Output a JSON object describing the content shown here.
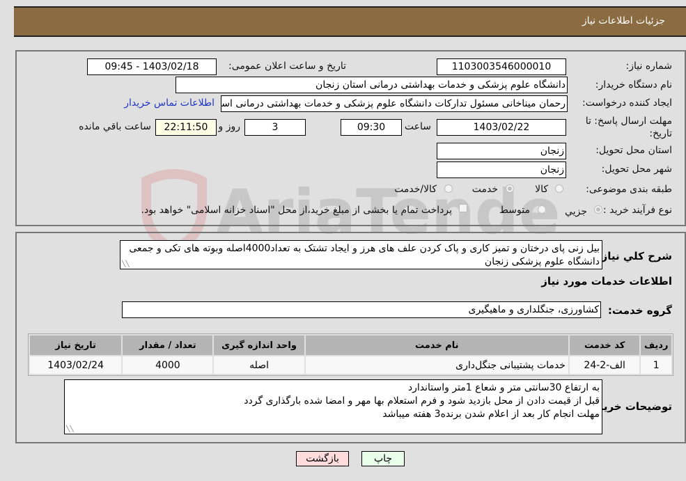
{
  "header": {
    "title": "جزئیات اطلاعات نیاز"
  },
  "fields": {
    "need_number_label": "شماره نیاز:",
    "need_number": "1103003546000010",
    "announce_label": "تاریخ و ساعت اعلان عمومی:",
    "announce_value": "1403/02/18 - 09:45",
    "buyer_org_label": "نام دستگاه خریدار:",
    "buyer_org": "دانشگاه علوم پزشکی و خدمات بهداشتی  درمانی استان زنجان",
    "creator_label": "ایجاد کننده درخواست:",
    "creator": "رحمان میناخانی مسئول تدارکات دانشگاه علوم پزشکی و خدمات بهداشتی  درمانی استان زنجان",
    "contact_link": "اطلاعات تماس خریدار",
    "deadline_label": "مهلت ارسال پاسخ: تا تاریخ:",
    "deadline_date": "1403/02/22",
    "time_label": "ساعت",
    "deadline_time": "09:30",
    "days_value": "3",
    "days_label": "روز و",
    "remaining_time": "22:11:50",
    "remaining_label": "ساعت باقي مانده",
    "province_label": "استان محل تحویل:",
    "province": "زنجان",
    "city_label": "شهر محل تحویل:",
    "city": "زنجان",
    "category_label": "طبقه بندی موضوعی:",
    "category_options": [
      "کالا",
      "خدمت",
      "کالا/خدمت"
    ],
    "category_selected": "خدمت",
    "process_label": "نوع فرآیند خرید :",
    "process_options": [
      "جزيي",
      "متوسط"
    ],
    "process_selected": "جزيي",
    "treasury_note": "پرداخت تمام یا بخشی از مبلغ خرید،از محل \"اسناد خزانه اسلامی\" خواهد بود."
  },
  "description": {
    "label": "شرح کلي نیاز:",
    "text": "بیل زنی پای درختان و تمیز کاری و پاک کردن علف های هرز و ایجاد تشتک  به تعداد4000اصله  وبوته های تکی و جمعی دانشگاه علوم پزشکی زنجان"
  },
  "services": {
    "section_title": "اطلاعات خدمات مورد نیاز",
    "group_label": "گروه خدمت:",
    "group_value": "کشاورزی، جنگلداری و ماهیگیری",
    "columns": [
      "ردیف",
      "کد خدمت",
      "نام خدمت",
      "واحد اندازه گیری",
      "تعداد / مقدار",
      "تاریخ نیاز"
    ],
    "rows": [
      {
        "index": "1",
        "code": "الف-2-24",
        "name": "خدمات پشتیبانی جنگل‌داری",
        "unit": "اصله",
        "quantity": "4000",
        "date": "1403/02/24"
      }
    ]
  },
  "buyer_notes": {
    "label": "توضیحات خریدار:",
    "lines": [
      "به ارتفاع 30سانتی متر و شعاع 1متر واستاندارد",
      "قبل از قیمت دادن از محل بازدید شود و فرم استعلام بها مهر و امضا شده بارگذاری گردد",
      "مهلت انجام کار بعد از اعلام شدن برنده3 هفته میباشد"
    ]
  },
  "buttons": {
    "print": "چاپ",
    "back": "بازگشت"
  },
  "watermark": {
    "text": "AriaTender.neT"
  }
}
